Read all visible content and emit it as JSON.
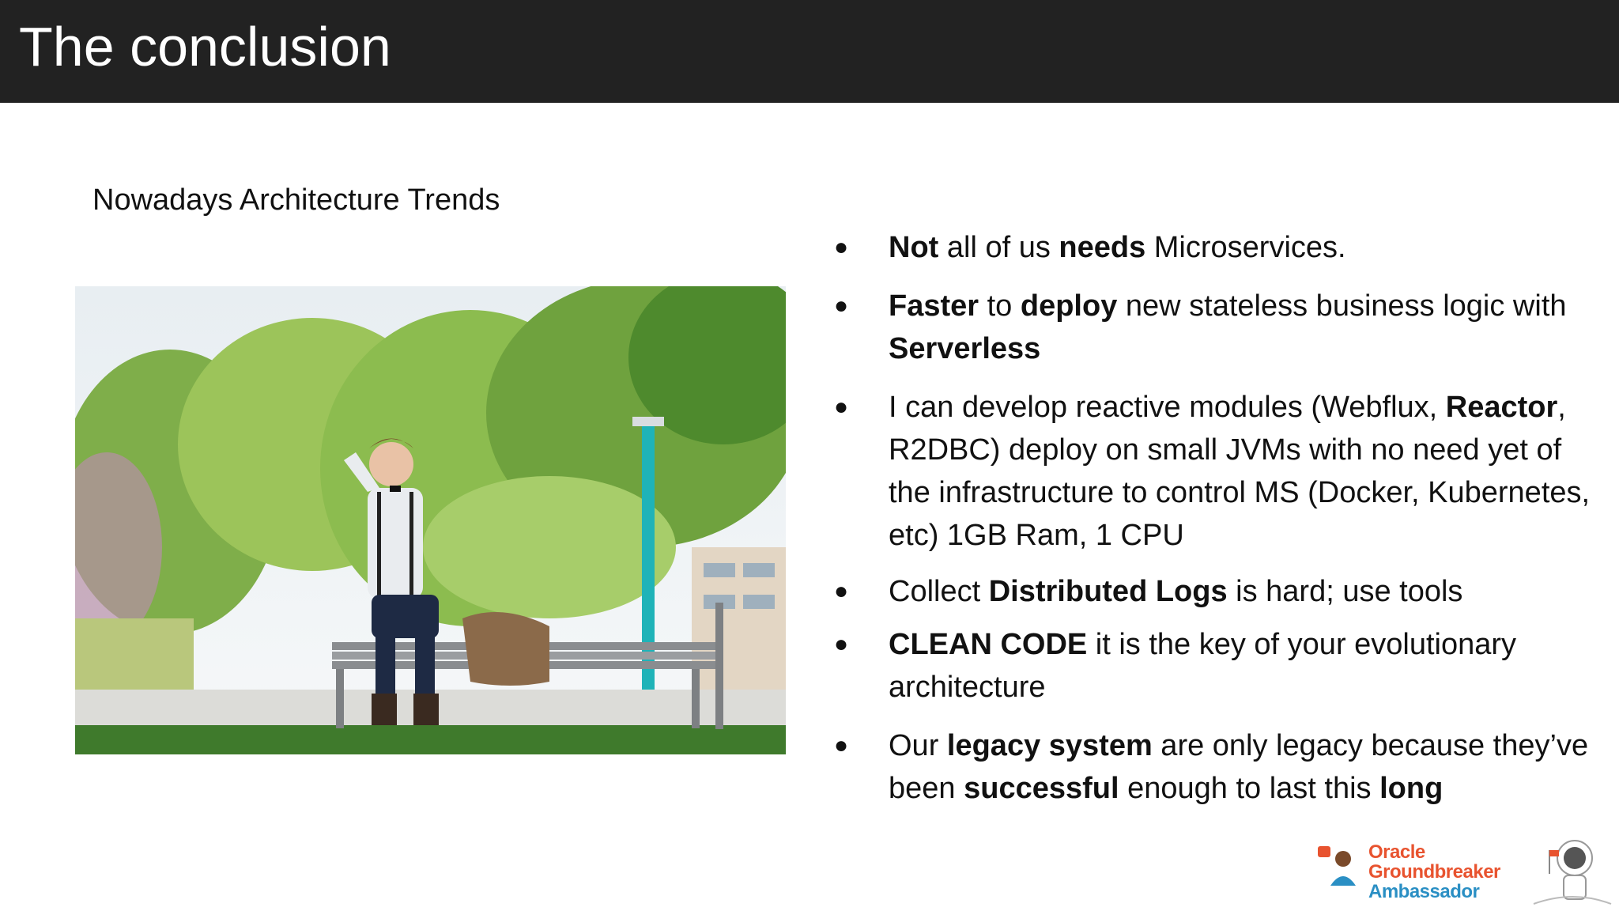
{
  "slide": {
    "title": "The conclusion",
    "subtitle": "Nowadays Architecture Trends"
  },
  "photo": {
    "description_icon": "man-on-bench-photo"
  },
  "bullets": [
    {
      "segments": [
        {
          "text": "Not",
          "bold": true
        },
        {
          "text": " all of us ",
          "bold": false
        },
        {
          "text": "needs",
          "bold": true
        },
        {
          "text": " Microservices.",
          "bold": false
        }
      ]
    },
    {
      "segments": [
        {
          "text": "Faster",
          "bold": true
        },
        {
          "text": " to ",
          "bold": false
        },
        {
          "text": "deploy",
          "bold": true
        },
        {
          "text": " new stateless business logic with ",
          "bold": false
        },
        {
          "text": "Serverless",
          "bold": true
        }
      ]
    },
    {
      "segments": [
        {
          "text": "I can develop reactive modules (Webflux, ",
          "bold": false
        },
        {
          "text": "Reactor",
          "bold": true
        },
        {
          "text": ", R2DBC) deploy on small JVMs with no need yet of the infrastructure to control MS (Docker, Kubernetes, etc) 1GB Ram, 1 CPU",
          "bold": false
        }
      ]
    },
    {
      "segments": [
        {
          "text": "Collect ",
          "bold": false
        },
        {
          "text": "Distributed Logs",
          "bold": true
        },
        {
          "text": " is hard; use tools",
          "bold": false
        }
      ]
    },
    {
      "segments": [
        {
          "text": "CLEAN CODE",
          "bold": true
        },
        {
          "text": " it is the key of your evolutionary architecture",
          "bold": false
        }
      ]
    },
    {
      "segments": [
        {
          "text": "Our ",
          "bold": false
        },
        {
          "text": "legacy system",
          "bold": true
        },
        {
          "text": " are only legacy because they’ve been ",
          "bold": false
        },
        {
          "text": "successful",
          "bold": true
        },
        {
          "text": " enough to last this ",
          "bold": false
        },
        {
          "text": "long",
          "bold": true
        }
      ]
    }
  ],
  "bullet_symbol": "●",
  "logo": {
    "line1": "Oracle",
    "line2": "Groundbreaker",
    "line3": "Ambassador",
    "colors": {
      "orange": "#e8532f",
      "blue": "#2a8fc4"
    }
  },
  "colors": {
    "title_bar": "#222222",
    "title_text": "#ffffff",
    "body_text": "#111111"
  }
}
